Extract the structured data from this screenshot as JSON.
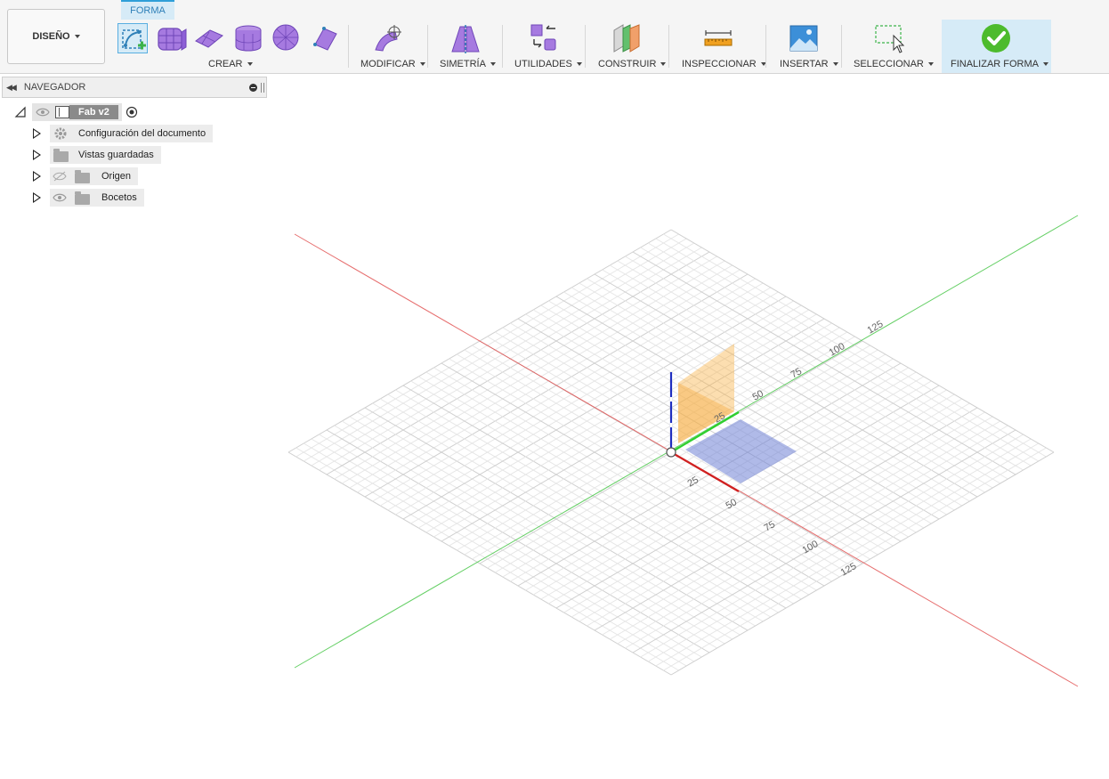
{
  "workspace": {
    "label": "DISEÑO"
  },
  "active_tab": {
    "label": "FORMA"
  },
  "toolbar": {
    "groups": [
      {
        "label": "CREAR"
      },
      {
        "label": "MODIFICAR"
      },
      {
        "label": "SIMETRÍA"
      },
      {
        "label": "UTILIDADES"
      },
      {
        "label": "CONSTRUIR"
      },
      {
        "label": "INSPECCIONAR"
      },
      {
        "label": "INSERTAR"
      },
      {
        "label": "SELECCIONAR"
      },
      {
        "label": "FINALIZAR FORMA"
      }
    ]
  },
  "navigator": {
    "title": "NAVEGADOR",
    "root": {
      "label": "Fab v2"
    },
    "items": [
      {
        "label": "Configuración del documento",
        "icon": "gear-icon"
      },
      {
        "label": "Vistas guardadas",
        "icon": "folder-icon"
      },
      {
        "label": "Origen",
        "icon": "folder-icon",
        "visibility": "hidden"
      },
      {
        "label": "Bocetos",
        "icon": "folder-icon",
        "visibility": "visible"
      }
    ]
  },
  "viewport": {
    "axis_ticks": {
      "green": [
        "25",
        "50",
        "75",
        "100",
        "125"
      ],
      "red": [
        "25",
        "50",
        "75",
        "100",
        "125"
      ]
    },
    "colors": {
      "x_axis": "#e04a4a",
      "y_axis": "#3fc43f",
      "z_axis": "#1f2ec0",
      "plane_orange": "#f7b042",
      "plane_blue": "#6f82d6",
      "accent": "#2f9fd8",
      "finish_green": "#4dbb2d"
    }
  }
}
